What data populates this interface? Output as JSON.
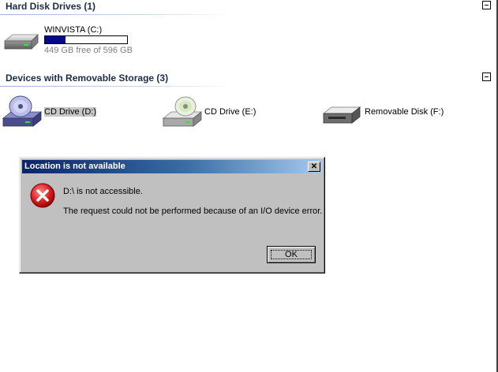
{
  "groups": {
    "hard_disk": {
      "header": "Hard Disk Drives (1)",
      "drives": [
        {
          "name": "WINVISTA (C:)",
          "space": "449 GB free of 596 GB",
          "used_fraction": 0.247
        }
      ]
    },
    "removable": {
      "header": "Devices with Removable Storage (3)",
      "drives": [
        {
          "name": "CD Drive (D:)"
        },
        {
          "name": "CD Drive (E:)"
        },
        {
          "name": "Removable Disk (F:)"
        }
      ]
    }
  },
  "dialog": {
    "title": "Location is not available",
    "close_glyph": "✕",
    "line1": "D:\\ is not accessible.",
    "line2": "The request could not be performed because of an I/O device error.",
    "ok_label": "OK"
  },
  "colors": {
    "capacity_fill": "#04088a",
    "titlebar_start": "#0a246a",
    "titlebar_end": "#a6caf0",
    "error_red": "#c8102e"
  }
}
